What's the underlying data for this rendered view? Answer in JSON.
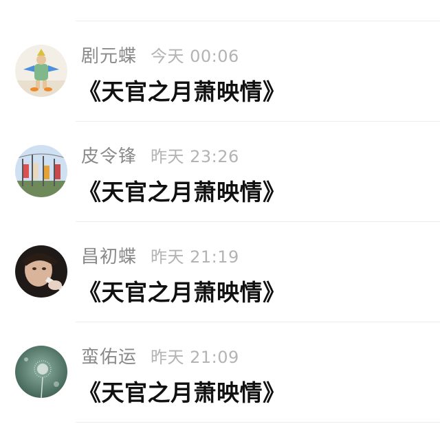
{
  "comments": [
    {
      "name": "剧元蝶",
      "time": "今天 00:06",
      "text": "《天官之月萧映情》",
      "avatar_icon": "person-in-costume-avatar"
    },
    {
      "name": "皮令锋",
      "time": "昨天 23:26",
      "text": "《天官之月萧映情》",
      "avatar_icon": "flags-sky-avatar"
    },
    {
      "name": "昌初蝶",
      "time": "昨天 21:19",
      "text": "《天官之月萧映情》",
      "avatar_icon": "face-dark-avatar"
    },
    {
      "name": "蛮佑运",
      "time": "昨天 21:09",
      "text": "《天官之月萧映情》",
      "avatar_icon": "dandelion-avatar"
    }
  ],
  "colors": {
    "name": "#8a8a8a",
    "time": "#b3b3b3",
    "message": "#111111",
    "divider": "#ededed"
  }
}
